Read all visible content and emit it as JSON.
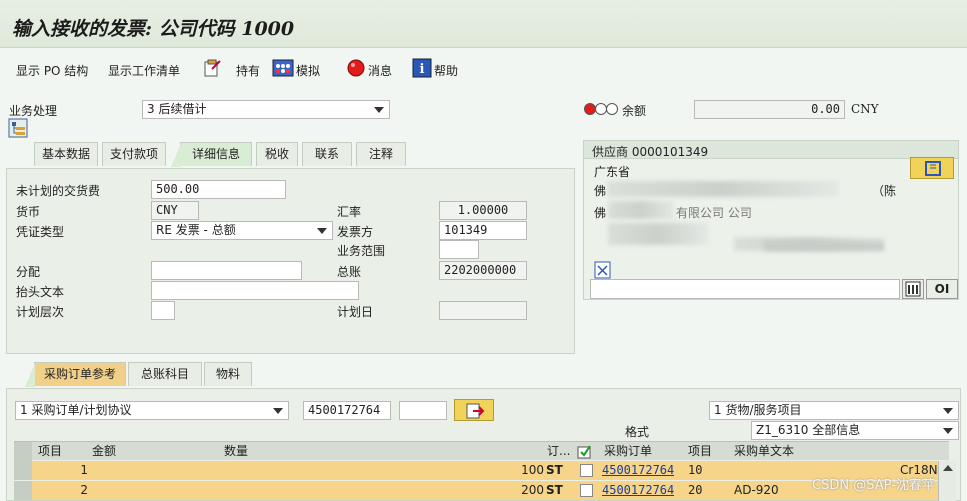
{
  "window": {
    "title": "输入接收的发票: 公司代码 1000"
  },
  "toolbar": {
    "show_po_structure": "显示 PO 结构",
    "show_worklist": "显示工作清单",
    "hold": "持有",
    "simulate": "模拟",
    "messages": "消息",
    "help": "帮助"
  },
  "header": {
    "transaction_label": "业务处理",
    "transaction_value": "3 后续借计",
    "balance_label": "余额",
    "balance_value": "0.00",
    "balance_currency": "CNY"
  },
  "tabs": [
    "基本数据",
    "支付款项",
    "详细信息",
    "税收",
    "联系",
    "注释"
  ],
  "details": {
    "unplanned_cost_label": "未计划的交货费",
    "unplanned_cost_value": "500.00",
    "currency_label": "货币",
    "currency_value": "CNY",
    "exchange_rate_label": "汇率",
    "exchange_rate_value": "1.00000",
    "doc_type_label": "凭证类型",
    "doc_type_value": "RE 发票 - 总额",
    "invoicing_party_label": "发票方",
    "invoicing_party_value": "101349",
    "business_area_label": "业务范围",
    "business_area_value": "",
    "assignment_label": "分配",
    "assignment_value": "",
    "gl_account_label": "总账",
    "gl_account_value": "2202000000",
    "header_text_label": "抬头文本",
    "header_text_value": "",
    "planning_level_label": "计划层次",
    "planning_date_label": "计划日",
    "planning_date_value": ""
  },
  "vendor": {
    "title": "供应商 0000101349",
    "province": "广东省",
    "line2_prefix": "佛",
    "line2_suffix": "（陈",
    "line3_prefix": "佛",
    "line3_mid": "有限公司 公司",
    "bottom_button": "OI"
  },
  "ref_tabs": [
    "采购订单参考",
    "总账科目",
    "物料"
  ],
  "po_ref": {
    "ref_type": "1 采购订单/计划协议",
    "po_number": "4500172764",
    "item_field": "",
    "item_type": "1 货物/服务项目",
    "layout_label": "格式",
    "layout_value": "Z1_6310 全部信息"
  },
  "grid": {
    "headers": [
      "项目",
      "金额",
      "数量",
      "订...",
      "采购订单",
      "项目",
      "采购单文本"
    ],
    "rows": [
      {
        "item": "1",
        "amount": "",
        "qty": "100",
        "unit": "ST",
        "po": "4500172764",
        "po_item": "10",
        "text": "",
        "extra": "Cr18N"
      },
      {
        "item": "2",
        "amount": "",
        "qty": "200",
        "unit": "ST",
        "po": "4500172764",
        "po_item": "20",
        "text": "AD-920",
        "extra": ""
      }
    ]
  },
  "watermark": "CSDN @SAP-沈春苹",
  "colors": {
    "background": "#f2f6f2",
    "row_highlight": "#f6d48a",
    "header_row": "#d6dcd3",
    "accent_blue": "#1a3d9a"
  }
}
